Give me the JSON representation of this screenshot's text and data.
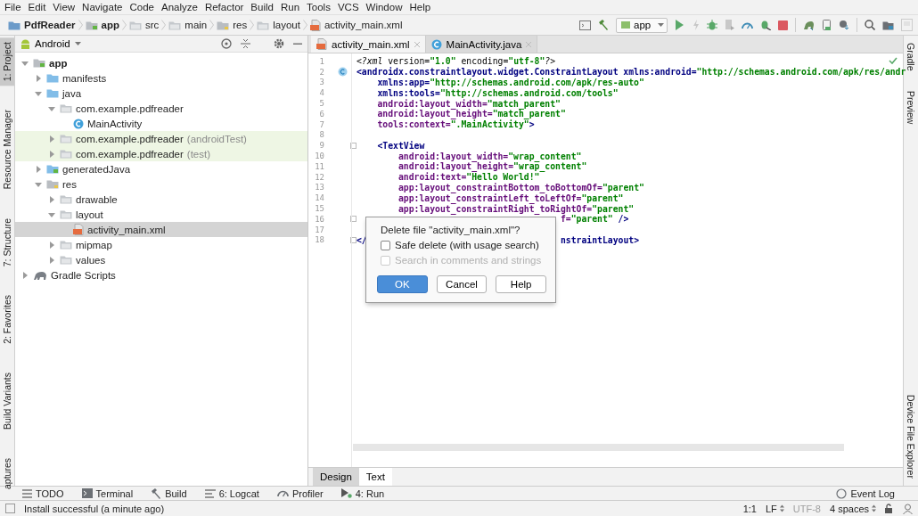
{
  "menu": [
    "File",
    "Edit",
    "View",
    "Navigate",
    "Code",
    "Analyze",
    "Refactor",
    "Build",
    "Run",
    "Tools",
    "VCS",
    "Window",
    "Help"
  ],
  "breadcrumbs": [
    {
      "label": "PdfReader",
      "kind": "project"
    },
    {
      "label": "app",
      "kind": "module"
    },
    {
      "label": "src",
      "kind": "folder"
    },
    {
      "label": "main",
      "kind": "folder"
    },
    {
      "label": "res",
      "kind": "res"
    },
    {
      "label": "layout",
      "kind": "folder"
    },
    {
      "label": "activity_main.xml",
      "kind": "xml"
    }
  ],
  "run_config": {
    "label": "app"
  },
  "left_tool_tabs": [
    {
      "label": "1: Project",
      "selected": true
    },
    {
      "label": "Resource Manager",
      "selected": false
    },
    {
      "label": "7: Structure",
      "selected": false
    },
    {
      "label": "2: Favorites",
      "selected": false
    },
    {
      "label": "Build Variants",
      "selected": false
    },
    {
      "label": "aptures",
      "selected": false
    }
  ],
  "project_panel": {
    "view": "Android",
    "tree": [
      {
        "label": "app",
        "kind": "module",
        "expanded": true,
        "selected": false,
        "highlighted": false,
        "children": [
          {
            "label": "manifests",
            "kind": "source",
            "expanded": false,
            "selected": false,
            "highlighted": false
          },
          {
            "label": "java",
            "kind": "source",
            "expanded": true,
            "selected": false,
            "highlighted": false,
            "children": [
              {
                "label": "com.example.pdfreader",
                "kind": "folder",
                "expanded": true,
                "selected": false,
                "highlighted": false,
                "children": [
                  {
                    "label": "MainActivity",
                    "kind": "class",
                    "selected": false,
                    "highlighted": false
                  }
                ]
              },
              {
                "label": "com.example.pdfreader",
                "suffix": "(androidTest)",
                "kind": "folder",
                "expanded": false,
                "selected": false,
                "highlighted": true
              },
              {
                "label": "com.example.pdfreader",
                "suffix": "(test)",
                "kind": "folder",
                "expanded": false,
                "selected": false,
                "highlighted": true
              }
            ]
          },
          {
            "label": "generatedJava",
            "kind": "generated",
            "expanded": false,
            "selected": false,
            "highlighted": false
          },
          {
            "label": "res",
            "kind": "res",
            "expanded": true,
            "selected": false,
            "highlighted": false,
            "children": [
              {
                "label": "drawable",
                "kind": "folder",
                "expanded": false,
                "selected": false,
                "highlighted": false
              },
              {
                "label": "layout",
                "kind": "folder",
                "expanded": true,
                "selected": false,
                "highlighted": false,
                "children": [
                  {
                    "label": "activity_main.xml",
                    "kind": "xml",
                    "selected": true,
                    "highlighted": false
                  }
                ]
              },
              {
                "label": "mipmap",
                "kind": "folder",
                "expanded": false,
                "selected": false,
                "highlighted": false
              },
              {
                "label": "values",
                "kind": "folder",
                "expanded": false,
                "selected": false,
                "highlighted": false
              }
            ]
          }
        ]
      },
      {
        "label": "Gradle Scripts",
        "kind": "gradle",
        "expanded": false,
        "selected": false,
        "highlighted": false
      }
    ]
  },
  "editor": {
    "tabs": [
      {
        "label": "activity_main.xml",
        "kind": "xml",
        "selected": true
      },
      {
        "label": "MainActivity.java",
        "kind": "class",
        "selected": false
      }
    ],
    "lines": [
      {
        "number": "1",
        "segments": [
          [
            {
              "text": "<?xml ",
              "kind": "pi"
            },
            {
              "text": "version=",
              "kind": "plain"
            },
            {
              "text": "\"1.0\"",
              "kind": "value"
            },
            {
              "text": " encoding=",
              "kind": "plain"
            },
            {
              "text": "\"utf-8\"",
              "kind": "value"
            },
            {
              "text": "?>",
              "kind": "pi"
            }
          ]
        ]
      },
      {
        "number": "2",
        "kind": "class-marker",
        "segments": [
          [
            {
              "text": "<androidx.constraintlayout.widget.ConstraintLayout",
              "kind": "tag"
            },
            {
              "text": " xmlns:android=",
              "kind": "ns"
            },
            {
              "text": "\"http://schemas.android.com/apk/res/andr",
              "kind": "value"
            }
          ]
        ]
      },
      {
        "number": "3",
        "segments": [
          [
            {
              "text": "    xmlns:app=",
              "kind": "ns"
            },
            {
              "text": "\"http://schemas.android.com/apk/res-auto\"",
              "kind": "value"
            }
          ]
        ]
      },
      {
        "number": "4",
        "segments": [
          [
            {
              "text": "    xmlns:tools=",
              "kind": "ns"
            },
            {
              "text": "\"http://schemas.android.com/tools\"",
              "kind": "value"
            }
          ]
        ]
      },
      {
        "number": "5",
        "segments": [
          [
            {
              "text": "    android:layout_width=",
              "kind": "attr"
            },
            {
              "text": "\"match_parent\"",
              "kind": "value"
            }
          ]
        ]
      },
      {
        "number": "6",
        "segments": [
          [
            {
              "text": "    android:layout_height=",
              "kind": "attr"
            },
            {
              "text": "\"match_parent\"",
              "kind": "value"
            }
          ]
        ]
      },
      {
        "number": "7",
        "segments": [
          [
            {
              "text": "    tools:context=",
              "kind": "attr"
            },
            {
              "text": "\".MainActivity\"",
              "kind": "value"
            },
            {
              "text": ">",
              "kind": "tag"
            }
          ]
        ]
      },
      {
        "number": "8"
      },
      {
        "number": "9",
        "kind": "fold",
        "segments": [
          [
            {
              "text": "    <TextView",
              "kind": "tag"
            }
          ]
        ]
      },
      {
        "number": "10",
        "segments": [
          [
            {
              "text": "        android:layout_width=",
              "kind": "attr"
            },
            {
              "text": "\"wrap_content\"",
              "kind": "value"
            }
          ]
        ]
      },
      {
        "number": "11",
        "segments": [
          [
            {
              "text": "        android:layout_height=",
              "kind": "attr"
            },
            {
              "text": "\"wrap_content\"",
              "kind": "value"
            }
          ]
        ]
      },
      {
        "number": "12",
        "segments": [
          [
            {
              "text": "        android:text=",
              "kind": "attr"
            },
            {
              "text": "\"Hello World!\"",
              "kind": "value"
            }
          ]
        ]
      },
      {
        "number": "13",
        "segments": [
          [
            {
              "text": "        app:layout_constraintBottom_toBottomOf=",
              "kind": "attr"
            },
            {
              "text": "\"parent\"",
              "kind": "value"
            }
          ]
        ]
      },
      {
        "number": "14",
        "segments": [
          [
            {
              "text": "        app:layout_constraintLeft_toLeftOf=",
              "kind": "attr"
            },
            {
              "text": "\"parent\"",
              "kind": "value"
            }
          ]
        ]
      },
      {
        "number": "15",
        "segments": [
          [
            {
              "text": "        app:layout_constraintRight_toRightOf=",
              "kind": "attr"
            },
            {
              "text": "\"parent\"",
              "kind": "value"
            }
          ]
        ]
      },
      {
        "number": "16",
        "kind": "fold",
        "segments": [
          [
            {
              "text": "                                       f=",
              "kind": "attr"
            },
            {
              "text": "\"parent\"",
              "kind": "value"
            },
            {
              "text": " />",
              "kind": "tag"
            }
          ]
        ]
      },
      {
        "number": "17"
      },
      {
        "number": "18",
        "kind": "fold",
        "segments": [
          [
            {
              "text": "</",
              "kind": "tag"
            }
          ],
          [
            {
              "text": "                                     nstraintLayout>",
              "kind": "tag"
            }
          ]
        ]
      }
    ],
    "mode_tabs": [
      {
        "label": "Design",
        "selected": false
      },
      {
        "label": "Text",
        "selected": true
      }
    ]
  },
  "right_tool_tabs": {
    "top": [
      {
        "label": "Gradle"
      },
      {
        "label": "Preview"
      }
    ],
    "bottom": [
      {
        "label": "Device File Explorer"
      }
    ]
  },
  "dialog": {
    "message": "Delete file \"activity_main.xml\"?",
    "options": [
      {
        "label": "Safe delete (with usage search)",
        "checked": false,
        "disabled": false
      },
      {
        "label": "Search in comments and strings",
        "checked": false,
        "disabled": true
      }
    ],
    "buttons": [
      {
        "label": "OK",
        "default": true
      },
      {
        "label": "Cancel",
        "default": false
      },
      {
        "label": "Help",
        "default": false
      }
    ]
  },
  "bottom_tool_tabs": {
    "left": [
      {
        "label": "TODO",
        "kind": "todo"
      },
      {
        "label": "Terminal",
        "kind": "terminal"
      },
      {
        "label": "Build",
        "kind": "build"
      },
      {
        "label": "6: Logcat",
        "kind": "logcat"
      },
      {
        "label": "Profiler",
        "kind": "profiler"
      },
      {
        "label": "4: Run",
        "kind": "run"
      }
    ],
    "right": [
      {
        "label": "Event Log",
        "kind": "log"
      }
    ]
  },
  "status_bar": {
    "message": "Install successful (a minute ago)",
    "position": "1:1",
    "line_separator": "LF",
    "encoding": "UTF-8",
    "indent": "4 spaces"
  }
}
